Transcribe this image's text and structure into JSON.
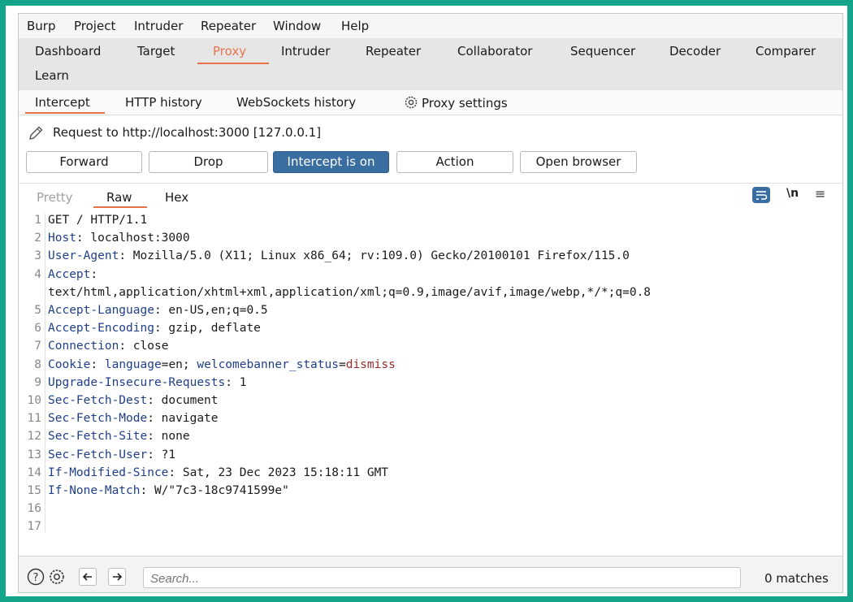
{
  "menubar": [
    "Burp",
    "Project",
    "Intruder",
    "Repeater",
    "Window",
    "Help"
  ],
  "main_tabs": [
    "Dashboard",
    "Target",
    "Proxy",
    "Intruder",
    "Repeater",
    "Collaborator",
    "Sequencer",
    "Decoder",
    "Comparer",
    "Learn"
  ],
  "active_main_tab": "Proxy",
  "sub_tabs": [
    "Intercept",
    "HTTP history",
    "WebSockets history",
    "Proxy settings"
  ],
  "active_sub_tab": "Intercept",
  "request_to": "Request to http://localhost:3000  [127.0.0.1]",
  "buttons": {
    "forward": "Forward",
    "drop": "Drop",
    "intercept": "Intercept is on",
    "action": "Action",
    "open_browser": "Open browser"
  },
  "editor_tabs": [
    "Pretty",
    "Raw",
    "Hex"
  ],
  "active_editor_tab": "Raw",
  "newline_toggle": "\\n",
  "request_lines": [
    {
      "n": "1",
      "text": "GET / HTTP/1.1"
    },
    {
      "n": "2",
      "key": "Host",
      "value": " localhost:3000"
    },
    {
      "n": "3",
      "key": "User-Agent",
      "value": " Mozilla/5.0 (X11; Linux x86_64; rv:109.0) Gecko/20100101 Firefox/115.0"
    },
    {
      "n": "4",
      "key": "Accept",
      "value": ""
    },
    {
      "n": "",
      "text": "text/html,application/xhtml+xml,application/xml;q=0.9,image/avif,image/webp,*/*;q=0.8"
    },
    {
      "n": "5",
      "key": "Accept-Language",
      "value": " en-US,en;q=0.5"
    },
    {
      "n": "6",
      "key": "Accept-Encoding",
      "value": " gzip, deflate"
    },
    {
      "n": "7",
      "key": "Connection",
      "value": " close"
    },
    {
      "n": "8",
      "key": "Cookie",
      "cookie": true
    },
    {
      "n": "9",
      "key": "Upgrade-Insecure-Requests",
      "value": " 1"
    },
    {
      "n": "10",
      "key": "Sec-Fetch-Dest",
      "value": " document"
    },
    {
      "n": "11",
      "key": "Sec-Fetch-Mode",
      "value": " navigate"
    },
    {
      "n": "12",
      "key": "Sec-Fetch-Site",
      "value": " none"
    },
    {
      "n": "13",
      "key": "Sec-Fetch-User",
      "value": " ?1"
    },
    {
      "n": "14",
      "key": "If-Modified-Since",
      "value": " Sat, 23 Dec 2023 15:18:11 GMT"
    },
    {
      "n": "15",
      "key": "If-None-Match",
      "value": " W/\"7c3-18c9741599e\""
    },
    {
      "n": "16",
      "text": ""
    },
    {
      "n": "17",
      "text": ""
    }
  ],
  "cookie": {
    "c1_name": "language",
    "c1_value": "en",
    "c2_name": "welcomebanner_status",
    "c2_value": "dismiss"
  },
  "search": {
    "placeholder": "Search..."
  },
  "matches": "0 matches",
  "colors": {
    "accent": "#e8734a",
    "primary_button": "#3a6ea0",
    "frame": "#12a58a"
  }
}
